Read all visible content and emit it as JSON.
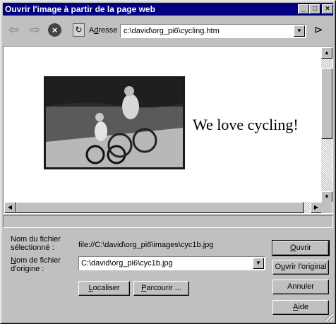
{
  "window": {
    "title": "Ouvrir l'image à partir de la page web"
  },
  "toolbar": {
    "address_label_prefix": "A",
    "address_label_underlined": "d",
    "address_label_rest": "resse",
    "address_value": "c:\\david\\org_pi6\\cycling.htm",
    "icons": [
      "back-arrow-icon",
      "forward-arrow-icon",
      "stop-icon",
      "refresh-icon",
      "go-folder-icon"
    ]
  },
  "page": {
    "caption": "We love cycling!",
    "image": "photo of two children riding bicycles"
  },
  "fields": {
    "selected_label_line1": "Nom du fichier",
    "selected_label_line2": "sélectionné :",
    "selected_value": "file://C:\\david\\org_pi6\\images\\cyc1b.jpg",
    "origin_label_line1_underlined": "N",
    "origin_label_line1_rest": "om de fichier",
    "origin_label_line2": "d'origine :",
    "origin_value": "C:\\david\\org_pi6\\cyc1b.jpg"
  },
  "buttons": {
    "localiser_u": "L",
    "localiser_rest": "ocaliser",
    "parcourir_u": "P",
    "parcourir_rest": "arcourir ...",
    "ouvrir_u": "O",
    "ouvrir_rest": "uvrir",
    "ouvrir_original_pre": "O",
    "ouvrir_original_u": "u",
    "ouvrir_original_rest": "vrir l'original",
    "annuler": "Annuler",
    "aide_u": "A",
    "aide_rest": "ide"
  }
}
